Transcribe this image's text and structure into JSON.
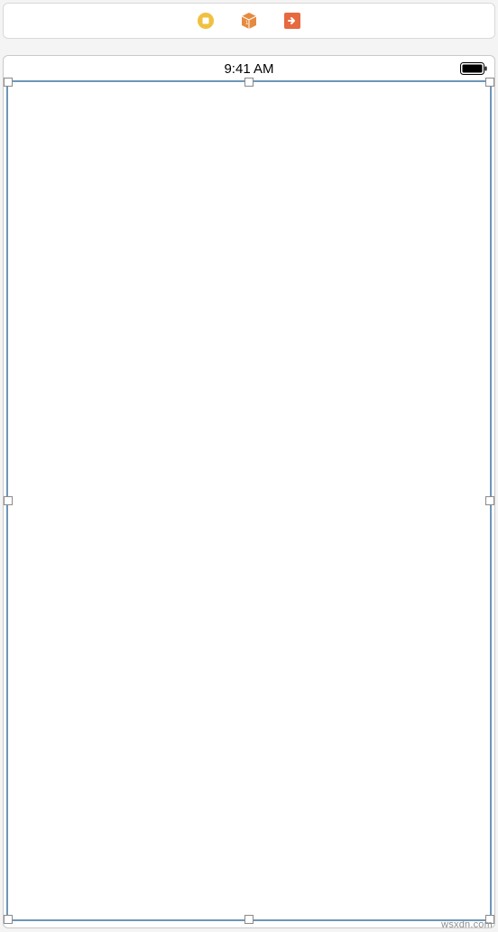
{
  "toolbar": {
    "icons": {
      "record": "record-icon",
      "cube": "cube-icon",
      "export": "export-icon"
    },
    "colors": {
      "record": "#f0c040",
      "cube": "#e68a3f",
      "export": "#e6693f"
    }
  },
  "statusbar": {
    "time": "9:41 AM",
    "battery_level": 100
  },
  "selection": {
    "label": "view-controller-root-view"
  },
  "watermark": "wsxdn.com"
}
